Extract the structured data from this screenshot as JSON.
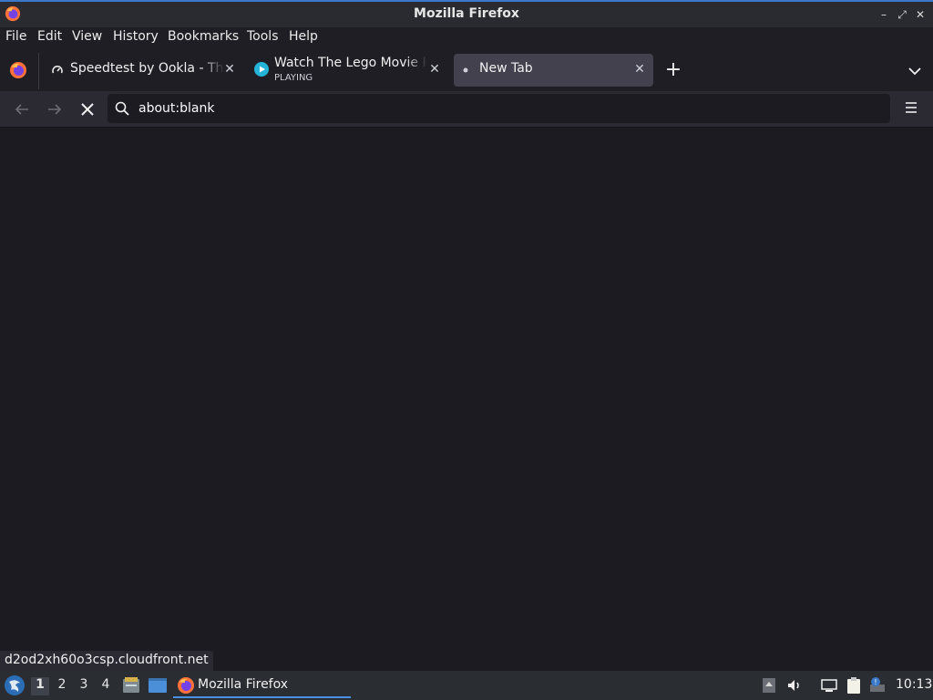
{
  "window": {
    "title": "Mozilla Firefox"
  },
  "menubar": {
    "items": [
      {
        "label": "File"
      },
      {
        "label": "Edit"
      },
      {
        "label": "View"
      },
      {
        "label": "History"
      },
      {
        "label": "Bookmarks"
      },
      {
        "label": "Tools"
      },
      {
        "label": "Help"
      }
    ]
  },
  "tabs": [
    {
      "label": "Speedtest by Ookla - The Global Broadband Speed Test",
      "icon": "speedtest-icon",
      "active": false
    },
    {
      "label": "Watch The Lego Movie Full Movie",
      "sublabel": "PLAYING",
      "icon": "play-icon",
      "active": false
    },
    {
      "label": "New Tab",
      "icon": "loading-dot-icon",
      "active": true
    }
  ],
  "urlbar": {
    "value": "about:blank"
  },
  "status": {
    "link": "d2od2xh60o3csp.cloudfront.net"
  },
  "taskbar": {
    "workspaces": [
      "1",
      "2",
      "3",
      "4"
    ],
    "active_workspace": "1",
    "task_label": "Mozilla Firefox",
    "clock": "10:13"
  },
  "colors": {
    "accent": "#3a78c9",
    "page_bg": "#1c1b22",
    "active_tab": "#42414d",
    "taskbar_highlight": "#4a90e2"
  }
}
